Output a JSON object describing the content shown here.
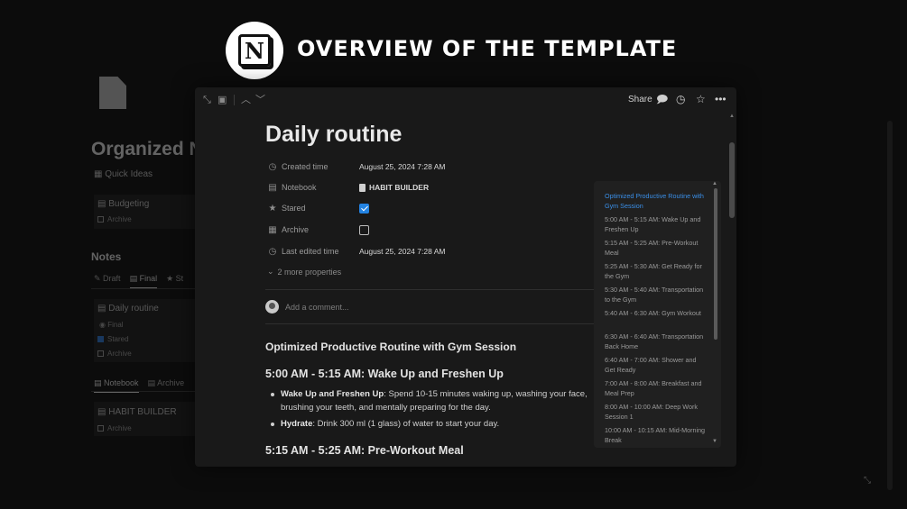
{
  "banner": {
    "logo_letter": "N",
    "title": "OVERVIEW OF THE TEMPLATE"
  },
  "background": {
    "title": "Organized N",
    "quick_ideas": "Quick Ideas",
    "budgeting": "Budgeting",
    "archive": "Archive",
    "notes_heading": "Notes",
    "tabs": [
      "Draft",
      "Final",
      "St"
    ],
    "daily_routine": "Daily routine",
    "final": "Final",
    "stared": "Stared",
    "bottom_tabs": [
      "Notebook",
      "Archive"
    ],
    "habit_builder": "HABIT BUILDER"
  },
  "topbar": {
    "share_label": "Share",
    "icons": [
      "expand-icon",
      "sidebar-icon",
      "chevron-up-icon",
      "chevron-down-icon",
      "comment-icon",
      "history-icon",
      "star-icon",
      "more-icon"
    ]
  },
  "page": {
    "title": "Daily routine",
    "properties": {
      "created": {
        "label": "Created time",
        "value": "August 25, 2024 7:28 AM"
      },
      "notebook": {
        "label": "Notebook",
        "value": "HABIT BUILDER"
      },
      "stared": {
        "label": "Stared",
        "checked": true
      },
      "archive": {
        "label": "Archive",
        "checked": false
      },
      "edited": {
        "label": "Last edited time",
        "value": "August 25, 2024 7:28 AM"
      }
    },
    "more_properties": "2 more properties",
    "comment_placeholder": "Add a comment...",
    "content_heading": "Optimized Productive Routine with Gym Session",
    "sections": [
      {
        "heading": "5:00 AM - 5:15 AM: Wake Up and Freshen Up",
        "bullets": [
          {
            "bold": "Wake Up and Freshen Up",
            "text": ": Spend 10-15 minutes waking up, washing your face, brushing your teeth, and mentally preparing for the day."
          },
          {
            "bold": "Hydrate",
            "text": ": Drink 300 ml (1 glass) of water to start your day."
          }
        ]
      },
      {
        "heading": "5:15 AM - 5:25 AM: Pre-Workout Meal",
        "bullets": []
      }
    ]
  },
  "toc": {
    "items": [
      "Optimized Productive Routine with Gym Session",
      "5:00 AM - 5:15 AM: Wake Up and Freshen Up",
      "5:15 AM - 5:25 AM: Pre-Workout Meal",
      "5:25 AM - 5:30 AM: Get Ready for the Gym",
      "5:30 AM - 5:40 AM: Transportation to the Gym",
      "5:40 AM - 6:30 AM: Gym Workout",
      "6:30 AM - 6:40 AM: Transportation Back Home",
      "6:40 AM - 7:00 AM: Shower and Get Ready",
      "7:00 AM - 8:00 AM: Breakfast and Meal Prep",
      "8:00 AM - 10:00 AM: Deep Work Session 1",
      "10:00 AM - 10:15 AM: Mid-Morning Break"
    ]
  },
  "colors": {
    "accent": "#2383e2",
    "toc_active": "#3a8fe8",
    "modal_bg": "#191919",
    "page_bg": "#0c0c0c"
  }
}
